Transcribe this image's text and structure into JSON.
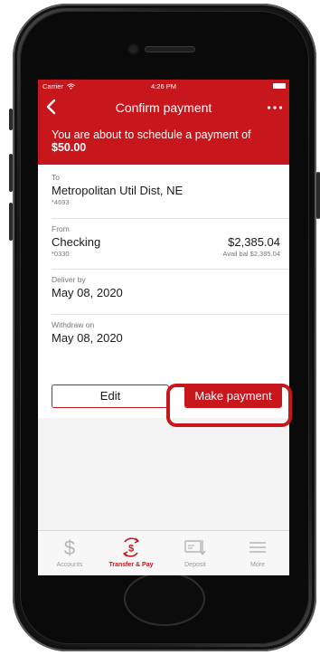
{
  "status_bar": {
    "carrier": "Carrier",
    "time": "4:26 PM"
  },
  "nav": {
    "title": "Confirm payment",
    "back_icon": "chevron-left-icon",
    "more_icon": "ellipsis-icon"
  },
  "banner": {
    "message": "You are about to schedule a payment of",
    "amount": "$50.00"
  },
  "payment": {
    "to": {
      "label": "To",
      "payee": "Metropolitan Util Dist, NE",
      "account": "*4693"
    },
    "from": {
      "label": "From",
      "account_name": "Checking",
      "account_number": "*0330",
      "balance": "$2,385.04",
      "available": "Avail bal $2,385.04"
    },
    "deliver_by": {
      "label": "Deliver by",
      "date": "May 08, 2020"
    },
    "withdraw_on": {
      "label": "Withdraw on",
      "date": "May 08, 2020"
    }
  },
  "actions": {
    "edit_label": "Edit",
    "make_payment_label": "Make payment"
  },
  "tabs": [
    {
      "label": "Accounts",
      "icon": "dollar-icon",
      "active": false
    },
    {
      "label": "Transfer & Pay",
      "icon": "transfer-dollar-icon",
      "active": true
    },
    {
      "label": "Deposit",
      "icon": "deposit-check-icon",
      "active": false
    },
    {
      "label": "More",
      "icon": "menu-icon",
      "active": false
    }
  ],
  "colors": {
    "brand": "#c8161d",
    "background": "#f3f3f3",
    "text": "#1a1a1a",
    "muted": "#767676"
  }
}
